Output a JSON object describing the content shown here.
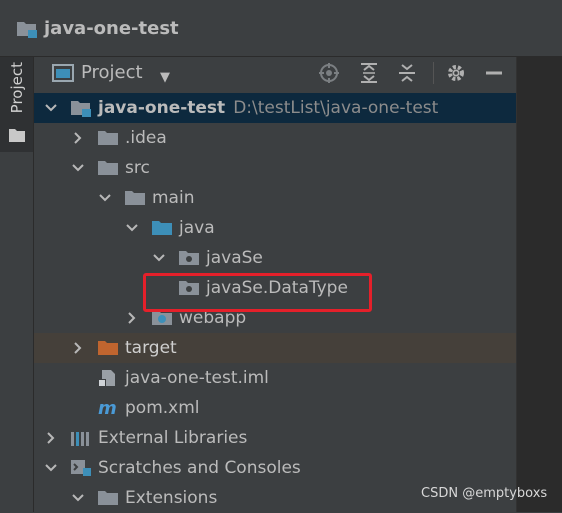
{
  "breadcrumb": {
    "title": "java-one-test"
  },
  "side": {
    "tab_label": "Project"
  },
  "toolbar": {
    "view_label": "Project",
    "buttons": [
      "locate-icon",
      "expand-all-icon",
      "collapse-all-icon",
      "gear-icon",
      "minimize-icon"
    ]
  },
  "tree": {
    "root": {
      "label": "java-one-test",
      "path": "D:\\testList\\java-one-test"
    },
    "idea": {
      "label": ".idea"
    },
    "src": {
      "label": "src"
    },
    "main": {
      "label": "main"
    },
    "java": {
      "label": "java"
    },
    "javaSe": {
      "label": "javaSe"
    },
    "datatype": {
      "label": "javaSe.DataType"
    },
    "webapp": {
      "label": "webapp"
    },
    "target": {
      "label": "target"
    },
    "iml": {
      "label": "java-one-test.iml"
    },
    "pom": {
      "label": "pom.xml"
    },
    "extlibs": {
      "label": "External Libraries"
    },
    "scratches": {
      "label": "Scratches and Consoles"
    },
    "extensions": {
      "label": "Extensions"
    }
  },
  "colors": {
    "selected_row": "#0d293e",
    "excluded_row": "#45403a",
    "folder_gray": "#8a9199",
    "folder_blue": "#3d8fb8",
    "folder_orange": "#c0652f",
    "highlight": "#e5202a"
  },
  "watermark": "CSDN @emptyboxs"
}
